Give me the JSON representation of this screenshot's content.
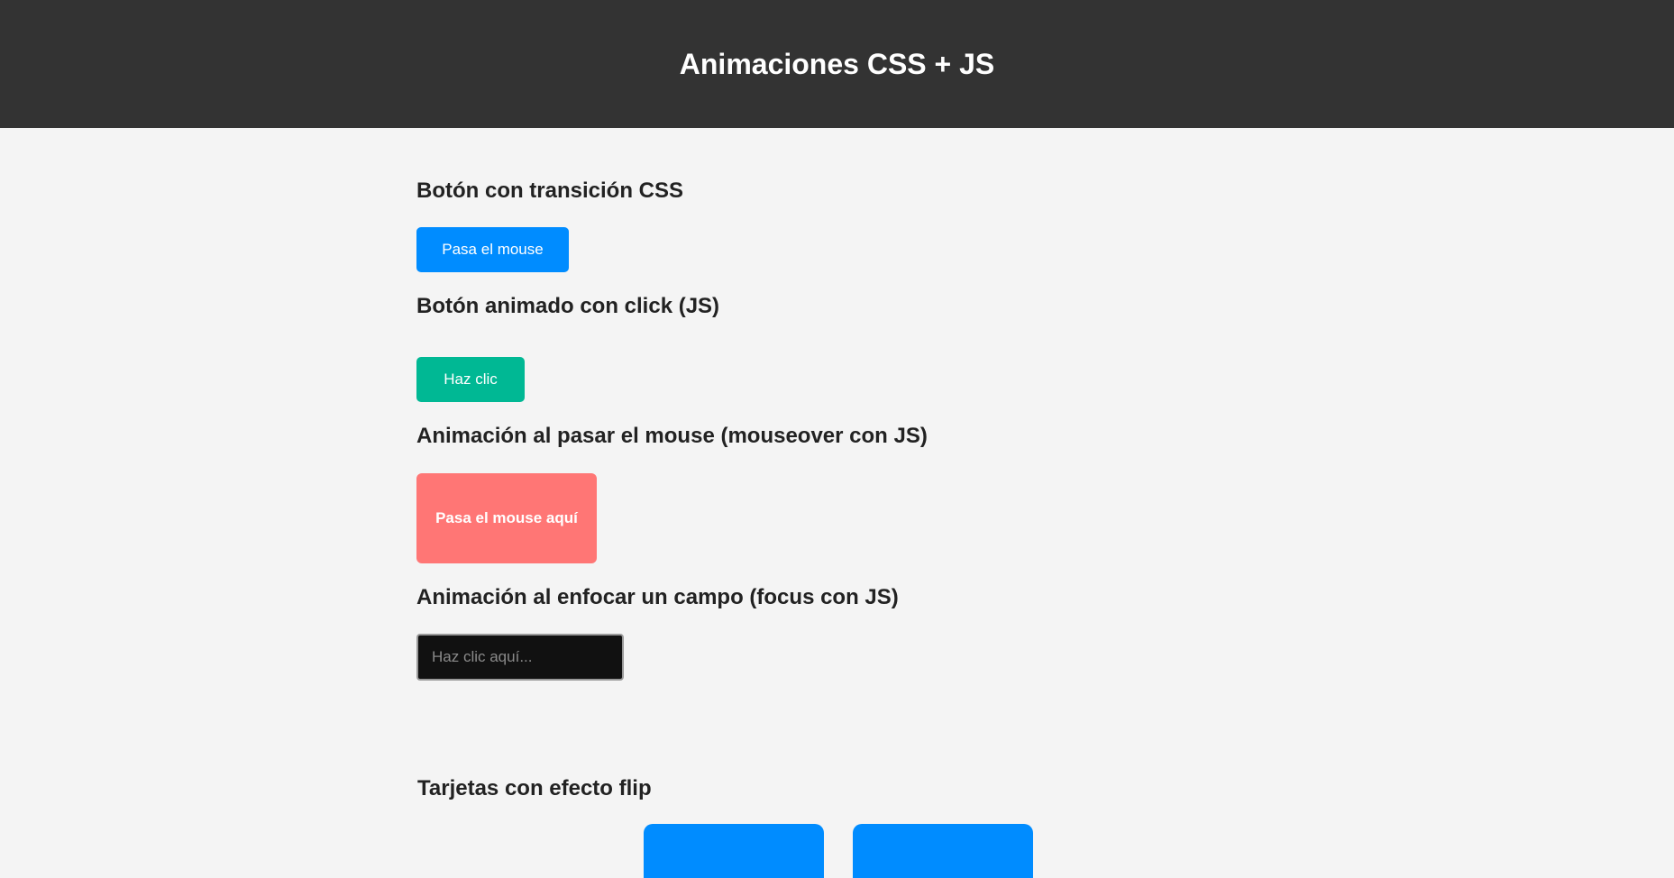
{
  "header": {
    "title": "Animaciones CSS + JS"
  },
  "sections": {
    "css_transition": {
      "title": "Botón con transición CSS",
      "button_label": "Pasa el mouse"
    },
    "click_animation": {
      "title": "Botón animado con click (JS)",
      "button_label": "Haz clic"
    },
    "mouseover_animation": {
      "title": "Animación al pasar el mouse (mouseover con JS)",
      "box_label": "Pasa el mouse aquí"
    },
    "focus_animation": {
      "title": "Animación al enfocar un campo (focus con JS)",
      "input_placeholder": "Haz clic aquí...",
      "input_value": ""
    },
    "flip_cards": {
      "title": "Tarjetas con efecto flip",
      "card_count": 2
    }
  },
  "colors": {
    "header_bg": "#333333",
    "page_bg": "#f4f4f4",
    "css_button": "#008cff",
    "click_button": "#00b894",
    "hover_box": "#ff7675",
    "input_bg": "#111111",
    "card": "#008cff"
  }
}
